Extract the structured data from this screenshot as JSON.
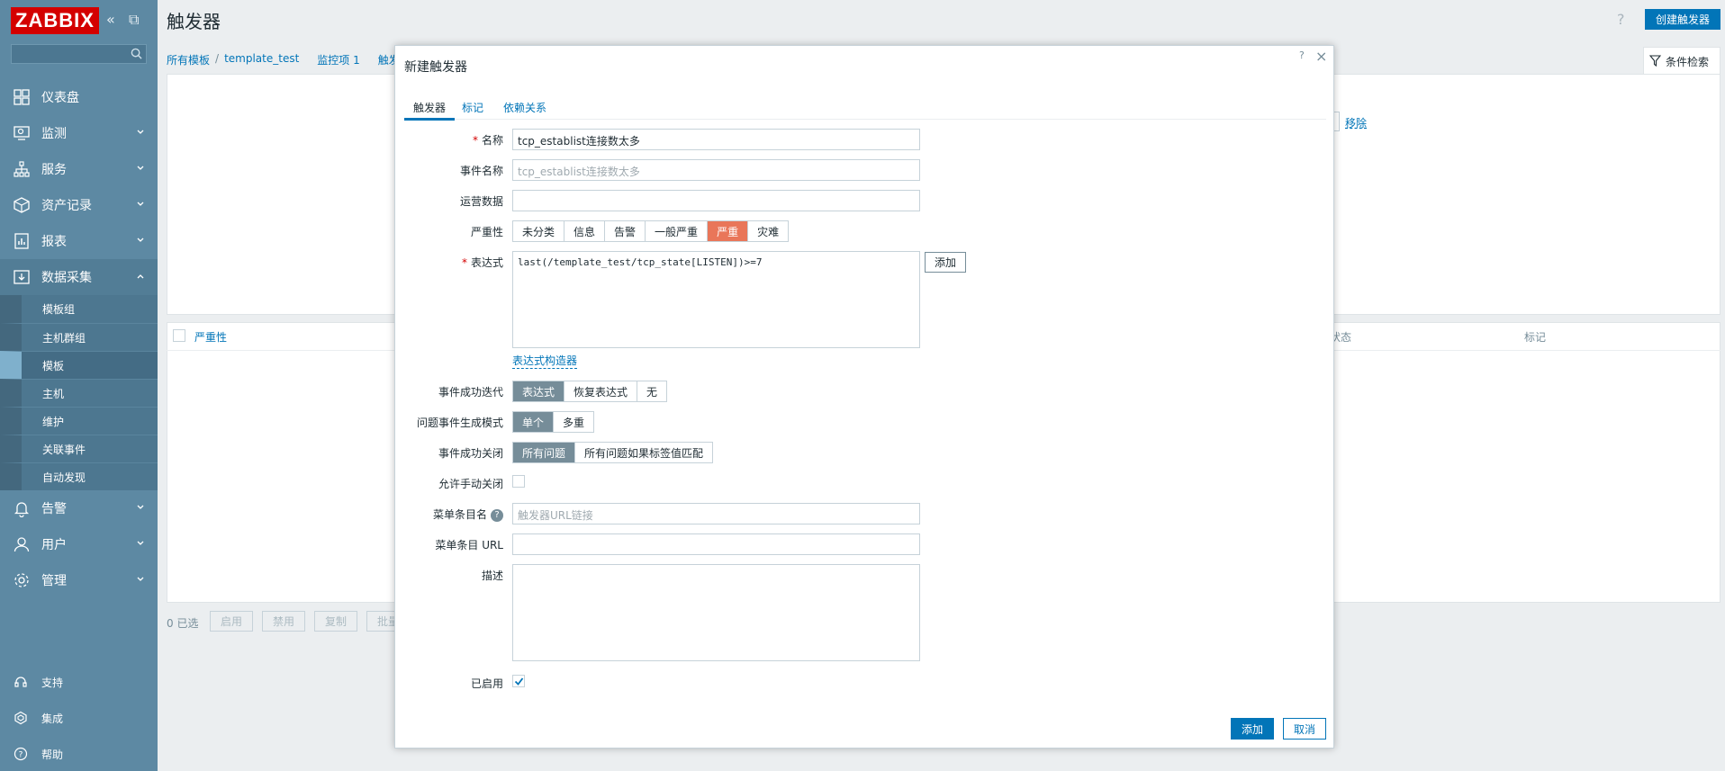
{
  "app": {
    "logo": "ZABBIX",
    "page_title": "触发器",
    "help": "?",
    "create_button": "创建触发器"
  },
  "sidebar": {
    "collapse_icon": "double-chevron-left-icon",
    "expand_icon": "window-icon",
    "search_placeholder": "",
    "items": [
      {
        "label": "仪表盘",
        "icon": "dashboard-icon"
      },
      {
        "label": "监测",
        "icon": "monitoring-icon"
      },
      {
        "label": "服务",
        "icon": "services-icon"
      },
      {
        "label": "资产记录",
        "icon": "inventory-icon"
      },
      {
        "label": "报表",
        "icon": "reports-icon"
      },
      {
        "label": "数据采集",
        "icon": "data-collection-icon"
      }
    ],
    "subitems": [
      "模板组",
      "主机群组",
      "模板",
      "主机",
      "维护",
      "关联事件",
      "自动发现"
    ],
    "items_after": [
      {
        "label": "告警",
        "icon": "bell-icon"
      },
      {
        "label": "用户",
        "icon": "user-icon"
      },
      {
        "label": "管理",
        "icon": "gear-icon"
      }
    ],
    "bottom": [
      {
        "label": "支持",
        "icon": "headset-icon"
      },
      {
        "label": "集成",
        "icon": "integrations-icon"
      },
      {
        "label": "帮助",
        "icon": "help-icon"
      }
    ]
  },
  "breadcrumb": {
    "item1": "所有模板",
    "sep": "/",
    "item2": "template_test",
    "item3": "监控项 1",
    "item4": "触发"
  },
  "filter": {
    "tab_label": "条件检索",
    "remove": "移除"
  },
  "table": {
    "col_severity": "严重性",
    "col_status": "状态",
    "col_tags": "标记"
  },
  "footer": {
    "selected": "0 已选",
    "enable": "启用",
    "disable": "禁用",
    "copy": "复制",
    "mass": "批量"
  },
  "dialog": {
    "title": "新建触发器",
    "help": "?",
    "close": "×",
    "tabs": [
      "触发器",
      "标记",
      "依赖关系"
    ],
    "fields": {
      "name_label": "名称",
      "name_value": "tcp_establist连接数太多",
      "event_name_label": "事件名称",
      "event_name_placeholder": "tcp_establist连接数太多",
      "opdata_label": "运营数据",
      "opdata_value": "",
      "severity_label": "严重性",
      "severity_options": [
        "未分类",
        "信息",
        "告警",
        "一般严重",
        "严重",
        "灾难"
      ],
      "severity_selected": "严重",
      "expression_label": "表达式",
      "expression_value": "last(/template_test/tcp_state[LISTEN])>=7",
      "expression_add": "添加",
      "expression_builder": "表达式构造器",
      "recovery_label": "事件成功迭代",
      "recovery_options": [
        "表达式",
        "恢复表达式",
        "无"
      ],
      "problem_mode_label": "问题事件生成模式",
      "problem_mode_options": [
        "单个",
        "多重"
      ],
      "ok_close_label": "事件成功关闭",
      "ok_close_options": [
        "所有问题",
        "所有问题如果标签值匹配"
      ],
      "manual_close_label": "允许手动关闭",
      "menu_name_label": "菜单条目名",
      "menu_name_placeholder": "触发器URL链接",
      "menu_url_label": "菜单条目 URL",
      "menu_url_value": "",
      "description_label": "描述",
      "description_value": "",
      "enabled_label": "已启用"
    },
    "add_button": "添加",
    "cancel_button": "取消"
  },
  "colors": {
    "accent": "#0275b8",
    "sidebar": "#5d89a3",
    "severity_high": "#e97659",
    "logo": "#d40000"
  }
}
